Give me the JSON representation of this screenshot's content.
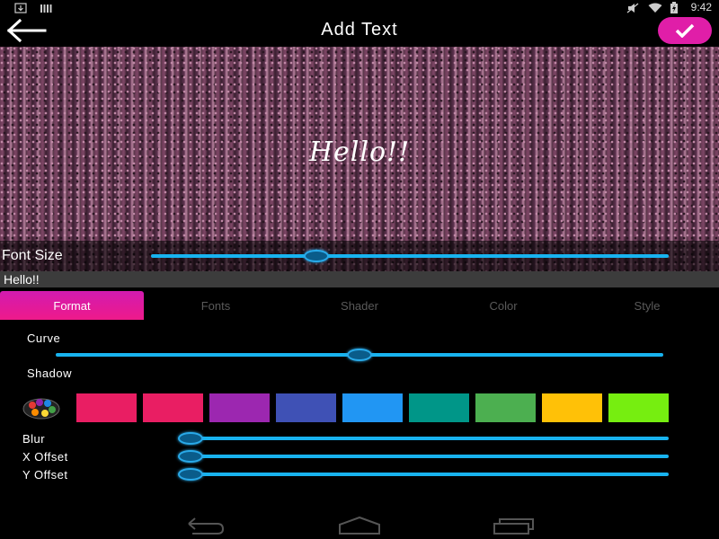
{
  "status_bar": {
    "time": "9:42",
    "icons_left": [
      "download-icon",
      "signal-bars-icon"
    ],
    "icons_right": [
      "mute-icon",
      "wifi-icon",
      "battery-charging-icon"
    ]
  },
  "action_bar": {
    "title": "Add Text",
    "back_icon": "back-arrow-icon",
    "confirm_icon": "checkmark-icon",
    "confirm_color": "#e01ea8"
  },
  "preview": {
    "text": "Hello!!"
  },
  "font_size": {
    "label": "Font Size",
    "value_fraction": 0.32
  },
  "text_input": {
    "value": "Hello!!"
  },
  "tabs": [
    {
      "label": "Format",
      "active": true
    },
    {
      "label": "Fonts",
      "active": false
    },
    {
      "label": "Shader",
      "active": false
    },
    {
      "label": "Color",
      "active": false
    },
    {
      "label": "Style",
      "active": false
    }
  ],
  "format": {
    "curve": {
      "label": "Curve",
      "value_fraction": 0.5
    },
    "shadow": {
      "label": "Shadow",
      "palette_icon": "color-palette-icon",
      "colors": [
        "#e91e63",
        "#e91e63",
        "#9c27b0",
        "#3f51b5",
        "#2196f3",
        "#009688",
        "#4caf50",
        "#ffc107",
        "#76ee10"
      ]
    },
    "blur": {
      "label": "Blur",
      "value_fraction": 0.0
    },
    "x_offset": {
      "label": "X Offset",
      "value_fraction": 0.0
    },
    "y_offset": {
      "label": "Y Offset",
      "value_fraction": 0.0
    }
  },
  "nav_bar": {
    "buttons": [
      "back-nav-icon",
      "home-nav-icon",
      "recents-nav-icon"
    ]
  },
  "colors": {
    "accent": "#18b3ef",
    "tab_active": "#e01ea8"
  }
}
